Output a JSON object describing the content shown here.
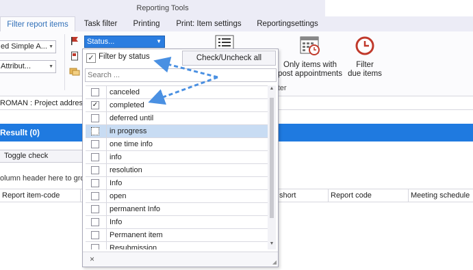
{
  "ribbon": {
    "context_title": "Reporting Tools",
    "tabs": [
      {
        "label": "Filter report items",
        "active": true
      },
      {
        "label": "Task filter"
      },
      {
        "label": "Printing"
      },
      {
        "label": "Print: Item settings"
      },
      {
        "label": "Reportingsettings"
      }
    ],
    "combo1": "ed Simple A...",
    "combo2": "Attribut...",
    "status_combo": "Status...",
    "big_button_1": "Only items with\npost appointments",
    "big_button_2": "Filter\ndue items",
    "group_label": "ced filter"
  },
  "path_text": "ROMAN : Project addressl",
  "result_title": "Resullt (0)",
  "toggle_check": "Toggle check",
  "group_hint": "olumn header here to grou",
  "columns": [
    "Report item-code",
    "short",
    "Report code",
    "Meeting schedule"
  ],
  "popup": {
    "filter_by_status_label": "Filter by status",
    "filter_by_status_checked": true,
    "check_all_label": "Check/Uncheck all",
    "search_placeholder": "Search ...",
    "items": [
      {
        "label": "canceled",
        "checked": false
      },
      {
        "label": "completed",
        "checked": true
      },
      {
        "label": "deferred until",
        "checked": false
      },
      {
        "label": "in progress",
        "checked": false,
        "selected": true
      },
      {
        "label": "one time info",
        "checked": false
      },
      {
        "label": "info",
        "checked": false
      },
      {
        "label": "resolution",
        "checked": false
      },
      {
        "label": "Info",
        "checked": false
      },
      {
        "label": "open",
        "checked": false
      },
      {
        "label": "permanent Info",
        "checked": false
      },
      {
        "label": "Info",
        "checked": false
      },
      {
        "label": "Permanent item",
        "checked": false
      },
      {
        "label": "Resubmission",
        "checked": false
      }
    ],
    "close_glyph": "×"
  },
  "colors": {
    "accent": "#1f7ae0",
    "selection": "#c8dcf3",
    "annotation_arrow": "#4a90e2"
  }
}
